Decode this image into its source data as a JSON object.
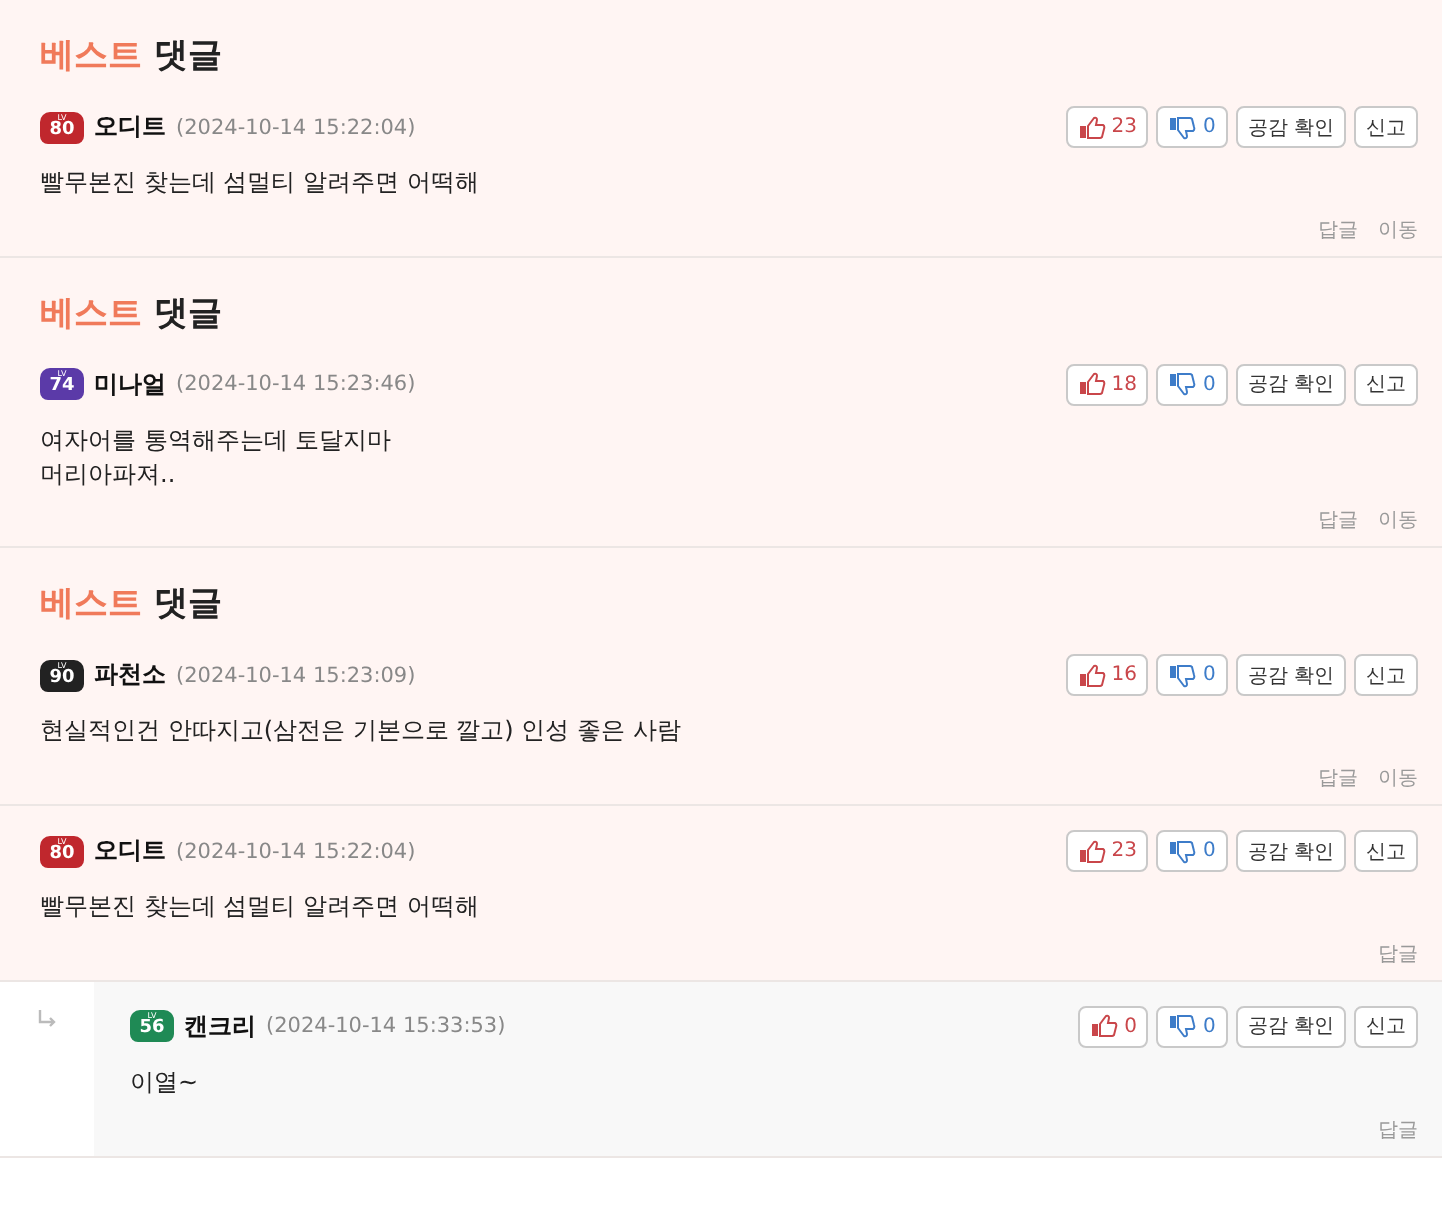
{
  "comments": [
    {
      "kind": "comment",
      "best": {
        "accent": "베스트",
        "text": "댓글"
      },
      "badge": {
        "lv": "LV",
        "level": "80",
        "color": "#c0272d"
      },
      "name": "오디트",
      "date": "(2024-10-14 15:22:04)",
      "body": [
        "빨무본진 찾는데 섬멀티 알려주면 어떡해"
      ],
      "likes": "23",
      "dislikes": "0",
      "buttons": [
        "공감 확인",
        "신고"
      ],
      "links": [
        "답글",
        "이동"
      ]
    },
    {
      "kind": "comment",
      "best": {
        "accent": "베스트",
        "text": "댓글"
      },
      "badge": {
        "lv": "LV",
        "level": "74",
        "color": "#5b3aa8"
      },
      "name": "미나얼",
      "date": "(2024-10-14 15:23:46)",
      "body": [
        "여자어를 통역해주는데 토달지마",
        "머리아파져.."
      ],
      "likes": "18",
      "dislikes": "0",
      "buttons": [
        "공감 확인",
        "신고"
      ],
      "links": [
        "답글",
        "이동"
      ]
    },
    {
      "kind": "comment",
      "best": {
        "accent": "베스트",
        "text": "댓글"
      },
      "badge": {
        "lv": "LV",
        "level": "90",
        "color": "#222222"
      },
      "name": "파천소",
      "date": "(2024-10-14 15:23:09)",
      "body": [
        "현실적인건 안따지고(삼전은 기본으로 깔고) 인성 좋은 사람"
      ],
      "likes": "16",
      "dislikes": "0",
      "buttons": [
        "공감 확인",
        "신고"
      ],
      "links": [
        "답글",
        "이동"
      ]
    },
    {
      "kind": "comment",
      "badge": {
        "lv": "LV",
        "level": "80",
        "color": "#c0272d"
      },
      "name": "오디트",
      "date": "(2024-10-14 15:22:04)",
      "body": [
        "빨무본진 찾는데 섬멀티 알려주면 어떡해"
      ],
      "likes": "23",
      "dislikes": "0",
      "buttons": [
        "공감 확인",
        "신고"
      ],
      "links": [
        "답글"
      ]
    },
    {
      "kind": "reply",
      "badge": {
        "lv": "LV",
        "level": "56",
        "color": "#1f8a55"
      },
      "name": "캔크리",
      "date": "(2024-10-14 15:33:53)",
      "body": [
        "이열~"
      ],
      "likes": "0",
      "dislikes": "0",
      "buttons": [
        "공감 확인",
        "신고"
      ],
      "links": [
        "답글"
      ]
    }
  ]
}
